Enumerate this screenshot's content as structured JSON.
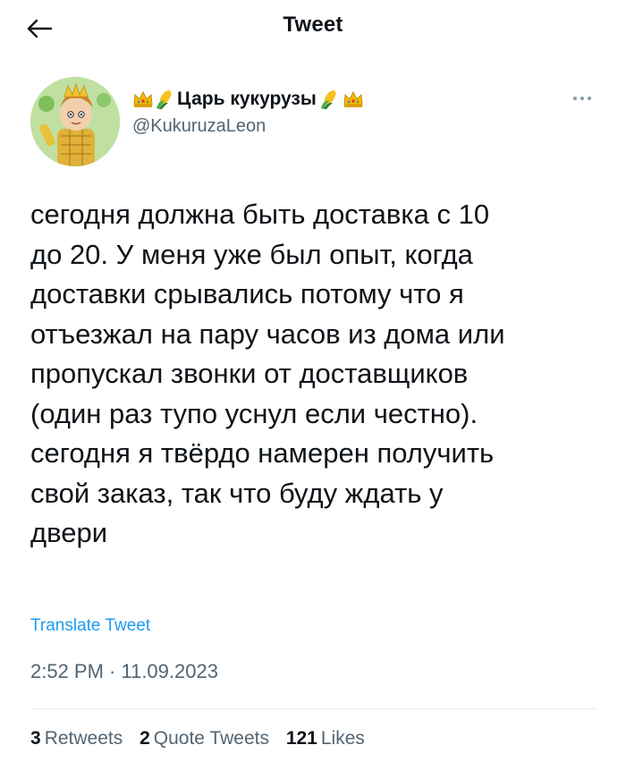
{
  "header": {
    "title": "Tweet",
    "back_icon": "arrow-left-icon"
  },
  "author": {
    "display_name": "Царь кукурузы",
    "name_emojis_left": [
      "crown-icon",
      "corn-icon"
    ],
    "name_emojis_right": [
      "corn-icon",
      "crown-icon"
    ],
    "handle": "@KukuruzaLeon",
    "more_icon": "more-dots-icon"
  },
  "tweet": {
    "text": "сегодня должна быть доставка с 10\nдо 20. У меня уже был опыт, когда\nдоставки срывались потому что я\nотъезжал на пару часов из дома или\nпропускал звонки от доставщиков\n(один раз тупо уснул если честно).\nсегодня я твёрдо намерен получить\nсвой заказ, так что буду ждать у\nдвери",
    "translate_label": "Translate Tweet",
    "timestamp": "2:52 PM · 11.09.2023"
  },
  "stats": {
    "retweets_count": "3",
    "retweets_label": "Retweets",
    "quotes_count": "2",
    "quotes_label": "Quote Tweets",
    "likes_count": "121",
    "likes_label": "Likes"
  },
  "colors": {
    "accent": "#1d9bf0",
    "secondary_text": "#536471",
    "primary_text": "#0f1419"
  }
}
